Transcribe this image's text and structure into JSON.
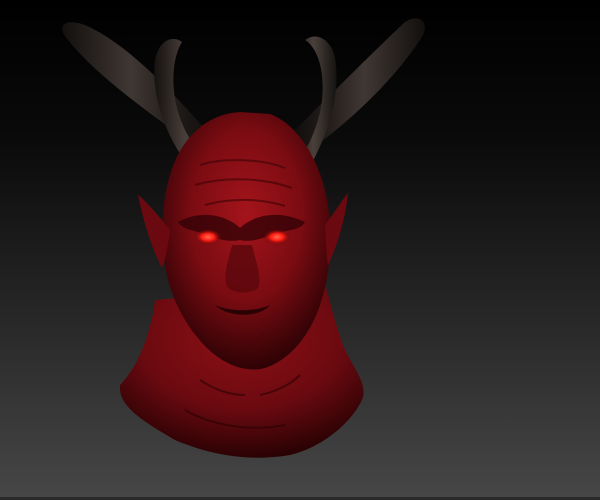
{
  "viewport": {
    "background_top": "#000000",
    "background_bottom": "#474747"
  },
  "model": {
    "subject": "horned-demon-bust",
    "skin_color": "#8a0f14",
    "skin_shadow": "#3a0306",
    "horn_color": "#2a2220",
    "eye_color": "#ff2a1e"
  }
}
